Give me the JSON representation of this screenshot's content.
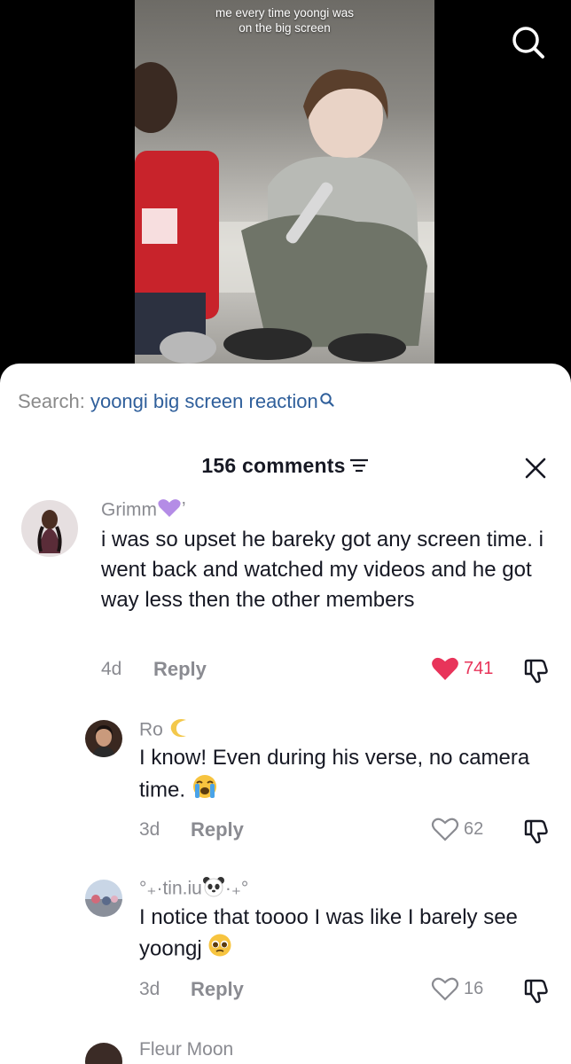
{
  "video": {
    "caption_line1": "me every time yoongi was",
    "caption_line2": "on the big screen",
    "search_button_icon": "search-icon"
  },
  "search": {
    "prefix": "Search:",
    "query": "yoongi big screen reaction"
  },
  "comments_header": {
    "count_label": "156 comments",
    "filter_icon": "filter-icon",
    "close_icon": "close-icon"
  },
  "comments": [
    {
      "username": "Grimm",
      "username_emoji": "purple-heart",
      "text": "i was so upset he bareky got any screen time. i went back and watched my videos and he got way less then the other members",
      "age": "4d",
      "reply_label": "Reply",
      "likes": "741",
      "liked": true
    },
    {
      "username": "Ro",
      "username_emoji": "crescent-moon",
      "text": "I know! Even during his verse, no camera time.",
      "text_emoji": "loudly-crying-face",
      "age": "3d",
      "reply_label": "Reply",
      "likes": "62",
      "liked": false
    },
    {
      "username": "°₊·tin.iu",
      "username_suffix": "·₊°",
      "username_emoji": "panda",
      "text": "I notice that toooo I was like I barely see yoongj",
      "text_emoji": "pleading-face",
      "age": "3d",
      "reply_label": "Reply",
      "likes": "16",
      "liked": false
    },
    {
      "username": "Fleur Moon"
    }
  ],
  "colors": {
    "sheet_bg": "#ffffff",
    "query_blue": "#2f5f9b",
    "like_red": "#e8345a",
    "muted_gray": "#8a8b91",
    "text_dark": "#161823"
  }
}
